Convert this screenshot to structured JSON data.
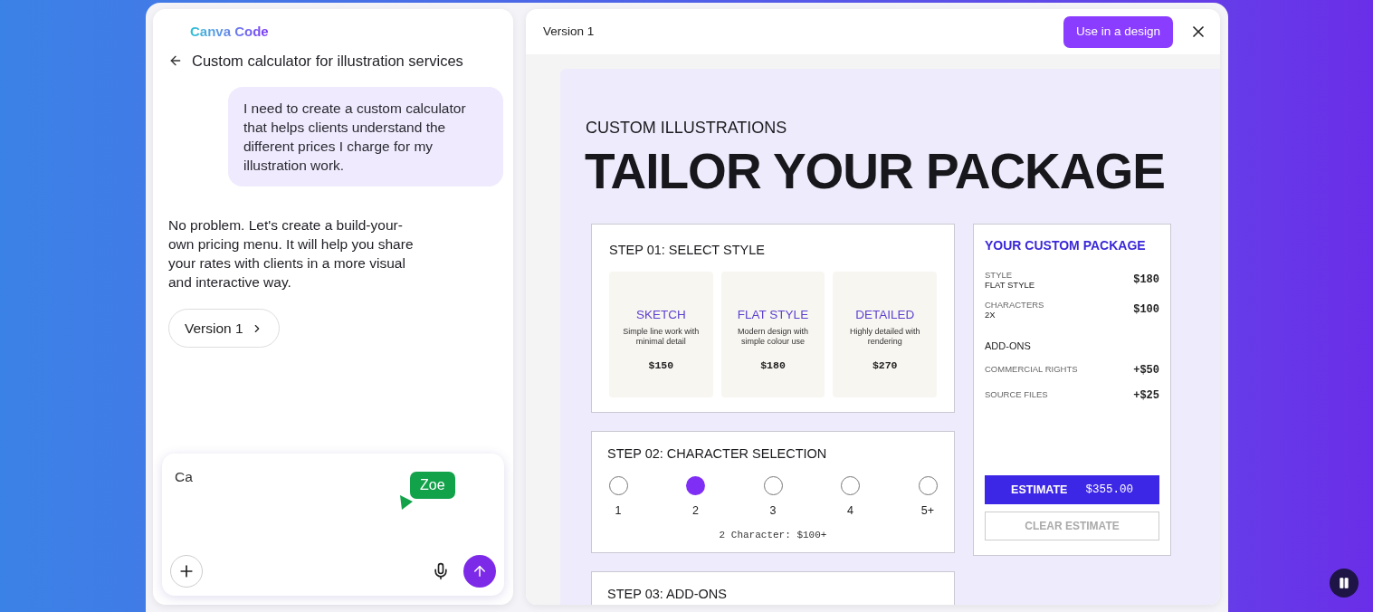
{
  "chat": {
    "brand": "Canva Code",
    "title": "Custom calculator for illustration services",
    "messages": [
      {
        "kind": "user",
        "text": "I need to create a custom calculator that helps clients understand the different prices I charge for my illustration work."
      },
      {
        "kind": "assistant",
        "text": "No problem. Let's create a build-your-own pricing menu. It will help you share your rates with clients in a more visual and interactive way."
      }
    ],
    "version_button": "Version 1",
    "composer": {
      "value": "Ca",
      "cursor_label": "Zoe"
    }
  },
  "preview": {
    "title": "Version 1",
    "action": "Use in a design",
    "page": {
      "eyebrow": "CUSTOM ILLUSTRATIONS",
      "heading": "TAILOR YOUR PACKAGE",
      "step1": {
        "title": "STEP 01: SELECT STYLE",
        "options": [
          {
            "name": "SKETCH",
            "description": "Simple line work with minimal detail",
            "price": "$150"
          },
          {
            "name": "FLAT STYLE",
            "description": "Modern design with simple colour use",
            "price": "$180"
          },
          {
            "name": "DETAILED",
            "description": "Highly detailed with rendering",
            "price": "$270"
          }
        ]
      },
      "step2": {
        "title": "STEP 02: CHARACTER SELECTION",
        "choices": [
          {
            "label": "1",
            "selected": false
          },
          {
            "label": "2",
            "selected": true
          },
          {
            "label": "3",
            "selected": false
          },
          {
            "label": "4",
            "selected": false
          },
          {
            "label": "5+",
            "selected": false
          }
        ],
        "note": "2 Character: $100+"
      },
      "step3": {
        "title": "STEP 03: ADD-ONS"
      },
      "summary": {
        "title": "YOUR CUSTOM PACKAGE",
        "lines": [
          {
            "label": "STYLE",
            "value": "FLAT STYLE",
            "price": "$180"
          },
          {
            "label": "CHARACTERS",
            "value": "2X",
            "price": "$100"
          }
        ],
        "addons_heading": "ADD-ONS",
        "addons": [
          {
            "label": "COMMERCIAL RIGHTS",
            "price": "+$50"
          },
          {
            "label": "SOURCE FILES",
            "price": "+$25"
          }
        ],
        "estimate": {
          "label": "ESTIMATE",
          "amount": "$355.00"
        },
        "clear": "CLEAR ESTIMATE"
      }
    }
  }
}
